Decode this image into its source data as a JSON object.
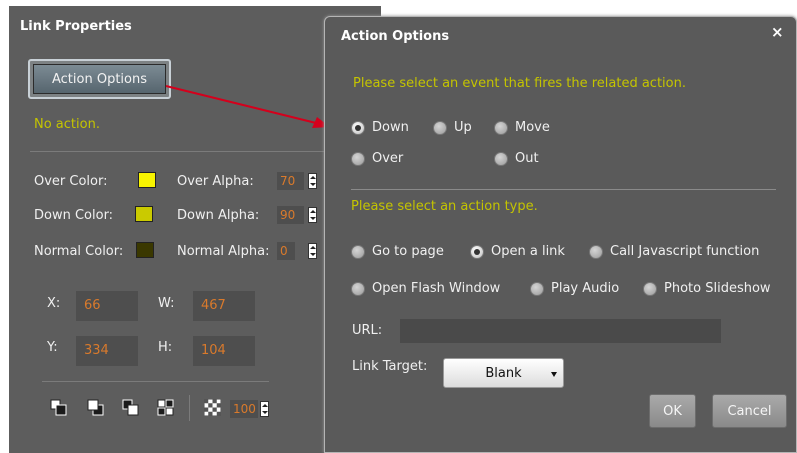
{
  "link_properties": {
    "title": "Link Properties",
    "action_button": "Action Options",
    "status": "No action.",
    "colors": [
      {
        "label": "Over Color:",
        "swatch": "#f8f400",
        "alpha_label": "Over Alpha:",
        "alpha": "70"
      },
      {
        "label": "Down Color:",
        "swatch": "#caca00",
        "alpha_label": "Down Alpha:",
        "alpha": "90"
      },
      {
        "label": "Normal Color:",
        "swatch": "#3a3800",
        "alpha_label": "Normal Alpha:",
        "alpha": "0"
      }
    ],
    "coords": {
      "x_label": "X:",
      "x": "66",
      "w_label": "W:",
      "w": "467",
      "y_label": "Y:",
      "y": "334",
      "h_label": "H:",
      "h": "104"
    },
    "toolbar": {
      "icons": [
        "bring-to-front-icon",
        "bring-forward-icon",
        "send-backward-icon",
        "send-to-back-icon",
        "transparency-icon"
      ],
      "opacity": "100"
    }
  },
  "dialog": {
    "title": "Action Options",
    "close_glyph": "×",
    "event_prompt": "Please select an event that fires the related action.",
    "events": [
      {
        "label": "Down",
        "selected": true
      },
      {
        "label": "Up",
        "selected": false
      },
      {
        "label": "Move",
        "selected": false
      },
      {
        "label": "Over",
        "selected": false
      },
      {
        "label": "Out",
        "selected": false
      }
    ],
    "type_prompt": "Please select an action type.",
    "action_types": [
      {
        "label": "Go to page",
        "selected": false
      },
      {
        "label": "Open a link",
        "selected": true
      },
      {
        "label": "Call Javascript function",
        "selected": false
      },
      {
        "label": "Open Flash Window",
        "selected": false
      },
      {
        "label": "Play Audio",
        "selected": false
      },
      {
        "label": "Photo Slideshow",
        "selected": false
      }
    ],
    "url_label": "URL:",
    "url_value": "",
    "target_label": "Link Target:",
    "target_value": "Blank",
    "ok": "OK",
    "cancel": "Cancel"
  },
  "colors": {
    "panel_bg": "#5d5d5d",
    "hint_text": "#c4c400",
    "value_text": "#d97a2c",
    "arrow": "#d4001c"
  }
}
